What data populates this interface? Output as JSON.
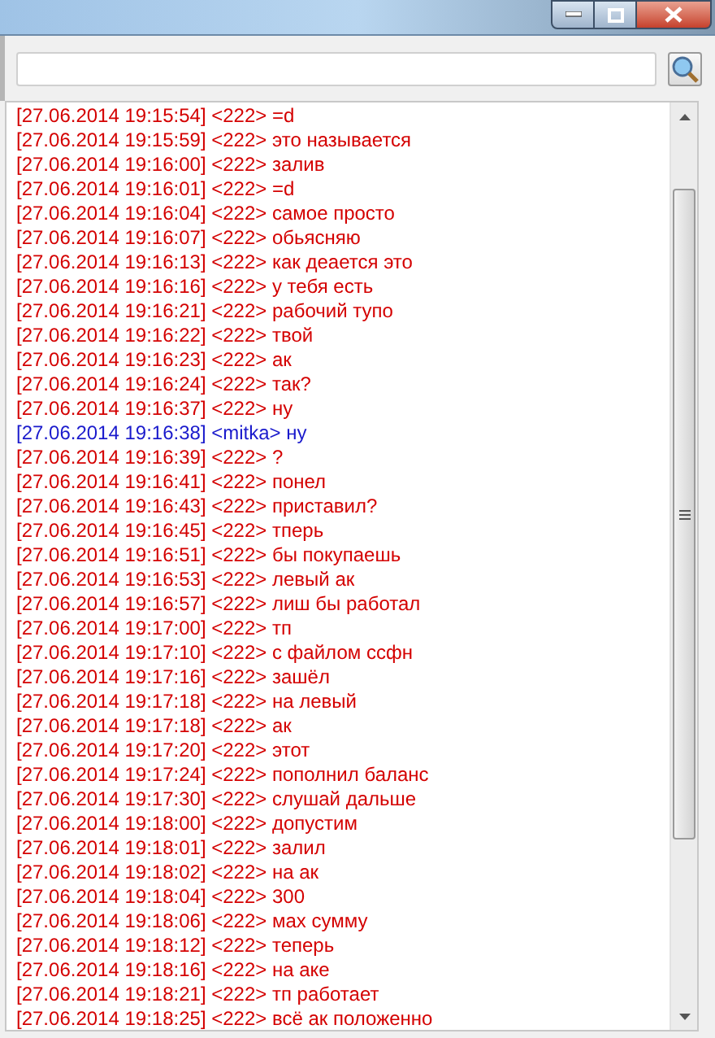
{
  "messages": [
    {
      "text": "[27.06.2014 19:15:54] <222> =d",
      "color": "#d40000"
    },
    {
      "text": "[27.06.2014 19:15:59] <222> это называется",
      "color": "#d40000"
    },
    {
      "text": "[27.06.2014 19:16:00] <222> залив",
      "color": "#d40000"
    },
    {
      "text": "[27.06.2014 19:16:01] <222> =d",
      "color": "#d40000"
    },
    {
      "text": "[27.06.2014 19:16:04] <222> самое просто",
      "color": "#d40000"
    },
    {
      "text": "[27.06.2014 19:16:07] <222> обьясняю",
      "color": "#d40000"
    },
    {
      "text": "[27.06.2014 19:16:13] <222> как деается это",
      "color": "#d40000"
    },
    {
      "text": "[27.06.2014 19:16:16] <222> у тебя есть",
      "color": "#d40000"
    },
    {
      "text": "[27.06.2014 19:16:21] <222> рабочий тупо",
      "color": "#d40000"
    },
    {
      "text": "[27.06.2014 19:16:22] <222> твой",
      "color": "#d40000"
    },
    {
      "text": "[27.06.2014 19:16:23] <222> ак",
      "color": "#d40000"
    },
    {
      "text": "[27.06.2014 19:16:24] <222> так?",
      "color": "#d40000"
    },
    {
      "text": "[27.06.2014 19:16:37] <222> ну",
      "color": "#d40000"
    },
    {
      "text": "[27.06.2014 19:16:38] <mitka> ну",
      "color": "#1a1acc"
    },
    {
      "text": "[27.06.2014 19:16:39] <222> ?",
      "color": "#d40000"
    },
    {
      "text": "[27.06.2014 19:16:41] <222> понел",
      "color": "#d40000"
    },
    {
      "text": "[27.06.2014 19:16:43] <222> приставил?",
      "color": "#d40000"
    },
    {
      "text": "[27.06.2014 19:16:45] <222> тперь",
      "color": "#d40000"
    },
    {
      "text": "[27.06.2014 19:16:51] <222> бы покупаешь",
      "color": "#d40000"
    },
    {
      "text": "[27.06.2014 19:16:53] <222> левый ак",
      "color": "#d40000"
    },
    {
      "text": "[27.06.2014 19:16:57] <222> лиш бы работал",
      "color": "#d40000"
    },
    {
      "text": "[27.06.2014 19:17:00] <222> тп",
      "color": "#d40000"
    },
    {
      "text": "[27.06.2014 19:17:10] <222> с файлом ссфн",
      "color": "#d40000"
    },
    {
      "text": "[27.06.2014 19:17:16] <222> зашёл",
      "color": "#d40000"
    },
    {
      "text": "[27.06.2014 19:17:18] <222> на левый",
      "color": "#d40000"
    },
    {
      "text": "[27.06.2014 19:17:18] <222> ак",
      "color": "#d40000"
    },
    {
      "text": "[27.06.2014 19:17:20] <222> этот",
      "color": "#d40000"
    },
    {
      "text": "[27.06.2014 19:17:24] <222> пополнил баланс",
      "color": "#d40000"
    },
    {
      "text": "[27.06.2014 19:17:30] <222> слушай дальше",
      "color": "#d40000"
    },
    {
      "text": "[27.06.2014 19:18:00] <222> допустим",
      "color": "#d40000"
    },
    {
      "text": "[27.06.2014 19:18:01] <222> залил",
      "color": "#d40000"
    },
    {
      "text": "[27.06.2014 19:18:02] <222> на ак",
      "color": "#d40000"
    },
    {
      "text": "[27.06.2014 19:18:04] <222> 300",
      "color": "#d40000"
    },
    {
      "text": "[27.06.2014 19:18:06] <222> мах сумму",
      "color": "#d40000"
    },
    {
      "text": "[27.06.2014 19:18:12] <222> теперь",
      "color": "#d40000"
    },
    {
      "text": "[27.06.2014 19:18:16] <222> на аке",
      "color": "#d40000"
    },
    {
      "text": "[27.06.2014 19:18:21] <222> тп работает",
      "color": "#d40000"
    },
    {
      "text": "[27.06.2014 19:18:25] <222> всё ак положенно",
      "color": "#d40000"
    }
  ]
}
